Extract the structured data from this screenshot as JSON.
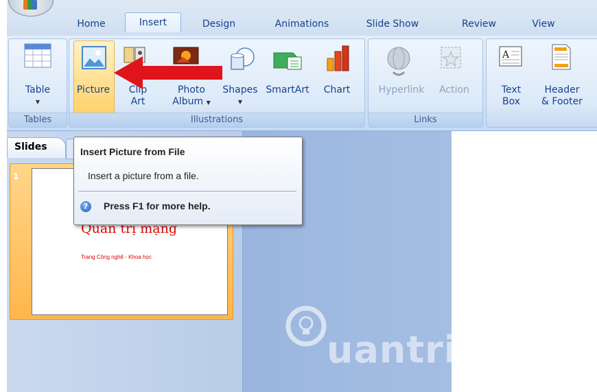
{
  "tabs": [
    {
      "label": "Home",
      "active": false
    },
    {
      "label": "Insert",
      "active": true
    },
    {
      "label": "Design",
      "active": false
    },
    {
      "label": "Animations",
      "active": false
    },
    {
      "label": "Slide Show",
      "active": false
    },
    {
      "label": "Review",
      "active": false
    },
    {
      "label": "View",
      "active": false
    }
  ],
  "ribbon": {
    "tables": {
      "label": "Tables",
      "table_btn": "Table"
    },
    "illustrations": {
      "label": "Illustrations",
      "picture": "Picture",
      "clipart_line1": "Clip",
      "clipart_line2": "Art",
      "photo_line1": "Photo",
      "photo_line2": "Album",
      "shapes": "Shapes",
      "smartart": "SmartArt",
      "chart": "Chart"
    },
    "links": {
      "label": "Links",
      "hyperlink": "Hyperlink",
      "action": "Action"
    },
    "text": {
      "textbox_line1": "Text",
      "textbox_line2": "Box",
      "header_line1": "Header",
      "header_line2": "& Footer",
      "textbox_icon_text": "A"
    }
  },
  "pane": {
    "slides_tab": "Slides",
    "slide_number": "1"
  },
  "slide": {
    "title": "Quản trị mạng",
    "subtitle": "Trang Công nghệ - Khoa học"
  },
  "tooltip": {
    "title": "Insert Picture from File",
    "description": "Insert a picture from a file.",
    "help": "Press F1 for more help.",
    "help_icon_glyph": "?"
  },
  "watermark": {
    "text": "uantrimang"
  },
  "colors": {
    "accent": "#15428b",
    "arrow": "#e0141b",
    "picture_highlight": "#ffd26b",
    "slide_text": "#e00000"
  }
}
